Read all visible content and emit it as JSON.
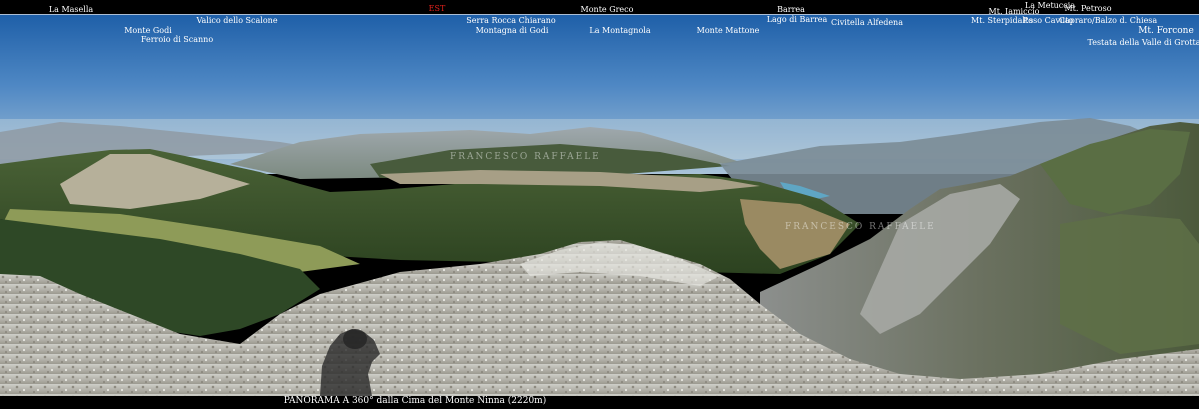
{
  "top_labels": [
    {
      "text": "La Masella",
      "red": false
    },
    {
      "text": "EST",
      "red": true
    },
    {
      "text": "Monte Greco",
      "red": false
    },
    {
      "text": "Barrea",
      "red": false
    },
    {
      "text": "La Metuccia",
      "red": false
    },
    {
      "text": "Mt. Petroso",
      "red": false
    }
  ],
  "sub_labels": [
    "Valico dello Scalone",
    "Monte Godi",
    "Ferroio di Scanno",
    "Serra Rocca Chiarano",
    "Montagna di Godi",
    "La Montagnola",
    "Monte Mattone",
    "Lago di Barrea",
    "Civitella Alfedena",
    "Mt. Iamiccio",
    "Mt. Sterpidalto",
    "P.sso Cavuto",
    "Capraro/Balzo d. Chiesa",
    "Mt. Forcone",
    "Testata della Valle di Grotta"
  ],
  "watermarks": [
    "FRANCESCO RAFFAELE",
    "FRANCESCO RAFFAELE"
  ],
  "caption": "PANORAMA A 360° dalla Cima del Monte Ninna (2220m)",
  "colors": {
    "label": "#ffffff",
    "est": "#e0201b",
    "background": "#000000"
  }
}
